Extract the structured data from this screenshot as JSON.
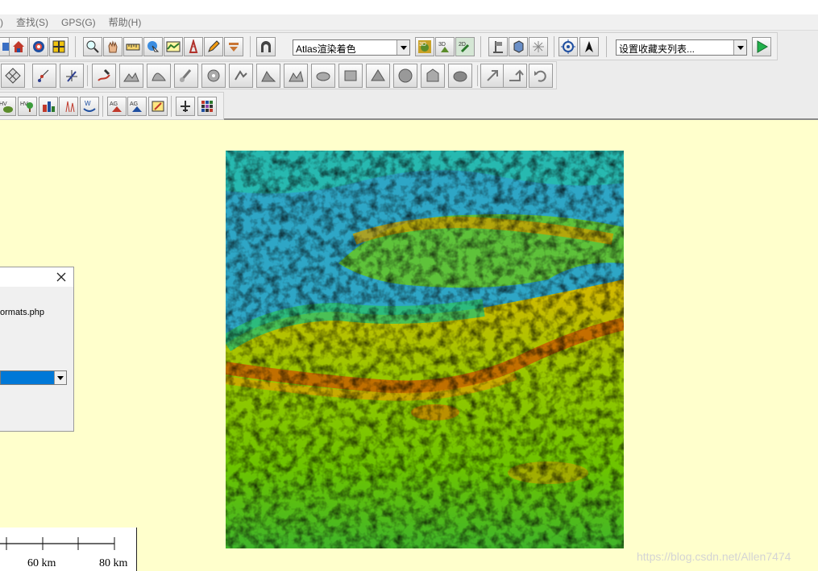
{
  "menu": {
    "items": [
      {
        "label": ")"
      },
      {
        "label": "查找(S)"
      },
      {
        "label": "GPS(G)"
      },
      {
        "label": "帮助(H)"
      }
    ]
  },
  "toolbar": {
    "shader_select": {
      "value": "Atlas渲染着色"
    },
    "favorites_select": {
      "value": "设置收藏夹列表..."
    }
  },
  "dialog": {
    "text": "ormats.php"
  },
  "scale": {
    "label_60": "60 km",
    "label_80": "80 km"
  },
  "watermark": "https://blog.csdn.net/Allen7474",
  "colors": {
    "canvas_bg": "#ffffcc",
    "accent_blue": "#0078d7",
    "play_green": "#22b14c"
  },
  "icons": [
    "home-icon",
    "globe-icon",
    "grid-icon",
    "zoom-in-icon",
    "hand-pan-icon",
    "ruler-icon",
    "select-icon",
    "profile-icon",
    "tower-icon",
    "pencil-icon",
    "dropdown-tool-icon",
    "arch-icon",
    "3d-view-icon",
    "3d-shade-icon",
    "contour-icon",
    "flag-icon",
    "cube-icon",
    "sparkle-icon",
    "target-icon",
    "north-arrow-icon",
    "play-icon"
  ]
}
